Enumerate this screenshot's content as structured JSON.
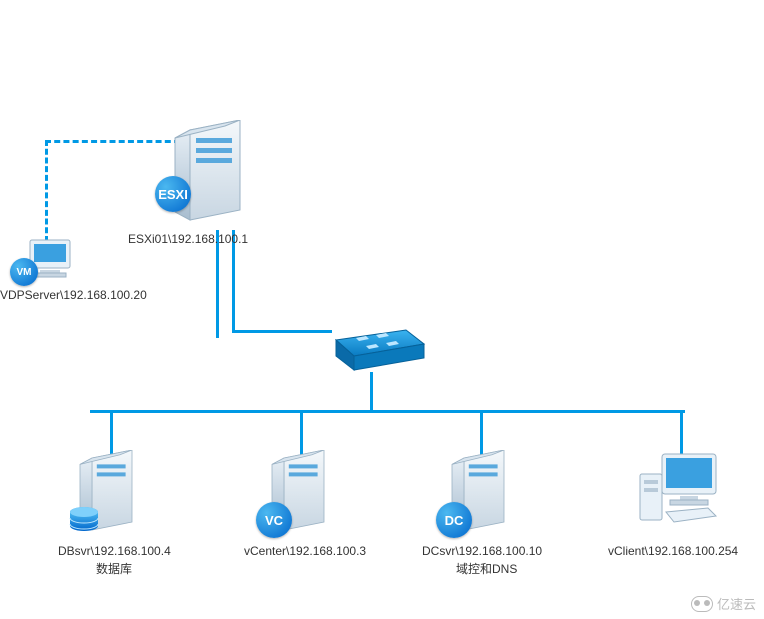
{
  "diagram": {
    "esxi": {
      "label": "ESXi01\\192.168.100.1",
      "badge": "ESXI"
    },
    "vdp": {
      "label": "VDPServer\\192.168.100.20",
      "badge": "VM"
    },
    "db": {
      "label": "DBsvr\\192.168.100.4",
      "sub": "数据库"
    },
    "vcenter": {
      "label": "vCenter\\192.168.100.3",
      "badge": "VC"
    },
    "dc": {
      "label": "DCsvr\\192.168.100.10",
      "sub": "域控和DNS",
      "badge": "DC"
    },
    "vclient": {
      "label": "vClient\\192.168.100.254"
    }
  },
  "watermark": "亿速云"
}
